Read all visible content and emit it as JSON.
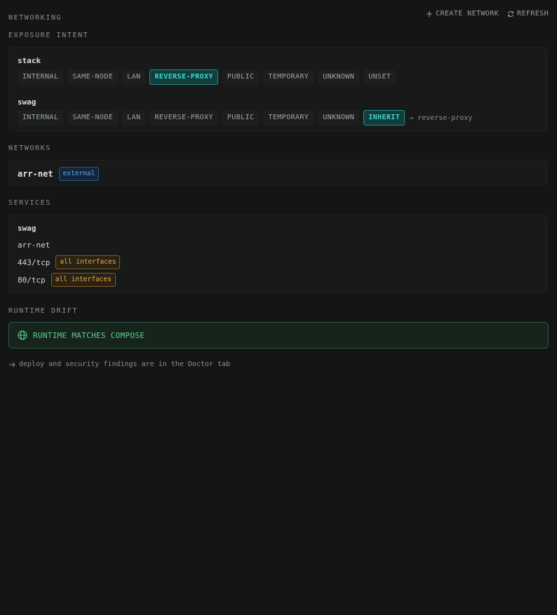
{
  "header": {
    "title": "NETWORKING",
    "create_label": "CREATE NETWORK",
    "refresh_label": "REFRESH"
  },
  "exposure": {
    "title": "EXPOSURE INTENT",
    "groups": [
      {
        "name": "stack",
        "options": [
          "INTERNAL",
          "SAME-NODE",
          "LAN",
          "REVERSE-PROXY",
          "PUBLIC",
          "TEMPORARY",
          "UNKNOWN",
          "UNSET"
        ],
        "selected": "REVERSE-PROXY"
      },
      {
        "name": "swag",
        "options": [
          "INTERNAL",
          "SAME-NODE",
          "LAN",
          "REVERSE-PROXY",
          "PUBLIC",
          "TEMPORARY",
          "UNKNOWN",
          "INHERIT"
        ],
        "selected": "INHERIT",
        "inherit_note": "→ reverse-proxy"
      }
    ]
  },
  "networks": {
    "title": "NETWORKS",
    "items": [
      {
        "name": "arr-net",
        "badge": "external"
      }
    ]
  },
  "services": {
    "title": "SERVICES",
    "service_name": "swag",
    "network": "arr-net",
    "ports": [
      {
        "port": "443/tcp",
        "binding": "all interfaces"
      },
      {
        "port": "80/tcp",
        "binding": "all interfaces"
      }
    ]
  },
  "drift": {
    "title": "RUNTIME DRIFT",
    "status": "RUNTIME MATCHES COMPOSE"
  },
  "footer": {
    "note": "deploy and security findings are in the Doctor tab"
  },
  "colors": {
    "accent_teal": "#3fd6d0",
    "success_green": "#5fd08c",
    "external_blue": "#5aa8ea",
    "warning_amber": "#e6b04a"
  }
}
